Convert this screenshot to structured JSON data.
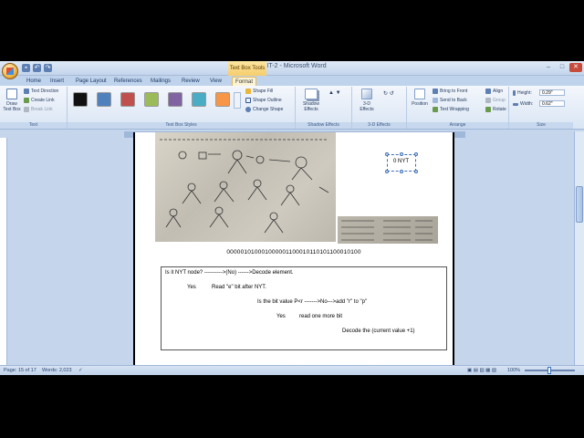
{
  "window": {
    "title": "UNIT-2 - Microsoft Word",
    "context_tab": "Text Box Tools"
  },
  "tabs": [
    "Home",
    "Insert",
    "Page Layout",
    "References",
    "Mailings",
    "Review",
    "View",
    "Format"
  ],
  "ribbon": {
    "text_group": {
      "draw_text_box": "Draw Text Box",
      "text_direction": "Text Direction",
      "create_link": "Create Link",
      "break_link": "Break Link",
      "label": "Text"
    },
    "styles_group": {
      "label": "Text Box Styles",
      "swatches": [
        "#111111",
        "#4f81bd",
        "#c0504d",
        "#9bbb59",
        "#8064a2",
        "#4bacc6",
        "#f79646"
      ],
      "shape_fill": "Shape Fill",
      "shape_outline": "Shape Outline",
      "change_shape": "Change Shape"
    },
    "shadow_group": {
      "button": "Shadow Effects",
      "label": "Shadow Effects"
    },
    "threed_group": {
      "button": "3-D Effects",
      "label": "3-D Effects"
    },
    "arrange_group": {
      "position": "Position",
      "bring_to_front": "Bring to Front",
      "send_to_back": "Send to Back",
      "text_wrapping": "Text Wrapping",
      "align": "Align",
      "group": "Group",
      "rotate": "Rotate",
      "label": "Arrange"
    },
    "size_group": {
      "height_label": "Height:",
      "height_value": "0.29\"",
      "width_label": "Width:",
      "width_value": "0.62\"",
      "label": "Size"
    }
  },
  "document": {
    "textbox_text": "0 NYT",
    "bit_string": "000001010001000001100010110101100010100",
    "flow": {
      "line1": "Is it NYT node? ---------->(No) ------>Decode element.",
      "yes1": "Yes",
      "read_bit": "Read \"e\" bit after NYT.",
      "line3": "Is the bit value  P<r  ------->No--->add \"r\" to \"p\"",
      "yes2": "Yes",
      "read_more": "read one more bit",
      "decode": "Decode the (current value +1)"
    }
  },
  "status": {
    "page": "Page: 15 of 17",
    "words": "Words: 2,023",
    "zoom": "100%"
  }
}
